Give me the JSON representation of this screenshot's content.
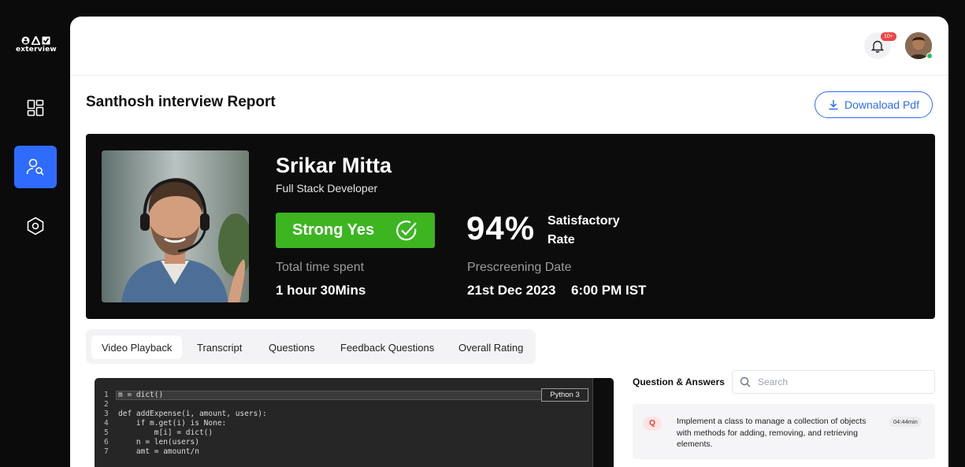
{
  "brand": {
    "name": "exterview"
  },
  "header": {
    "notification_count": "10+"
  },
  "page": {
    "title": "Santhosh interview Report",
    "download_label": "Downaload Pdf"
  },
  "candidate": {
    "name": "Srikar Mitta",
    "role": "Full Stack Developer",
    "verdict": "Strong Yes",
    "score_percent": "94%",
    "score_label_line1": "Satisfactory",
    "score_label_line2": "Rate",
    "time_label": "Total time spent",
    "time_value": "1 hour 30Mins",
    "date_label": "Prescreening Date",
    "date_value": "21st Dec 2023",
    "time_of_day": "6:00 PM IST"
  },
  "tabs": [
    {
      "label": "Video Playback",
      "active": true
    },
    {
      "label": "Transcript",
      "active": false
    },
    {
      "label": "Questions",
      "active": false
    },
    {
      "label": "Feedback Questions",
      "active": false
    },
    {
      "label": "Overall Rating",
      "active": false
    }
  ],
  "code": {
    "language": "Python 3",
    "lines": [
      {
        "n": "1",
        "text": "m = dict()"
      },
      {
        "n": "2",
        "text": ""
      },
      {
        "n": "3",
        "text": "def addExpense(i, amount, users):"
      },
      {
        "n": "4",
        "text": "    if m.get(i) is None:"
      },
      {
        "n": "5",
        "text": "        m[i] = dict()"
      },
      {
        "n": "6",
        "text": "    n = len(users)"
      },
      {
        "n": "7",
        "text": "    amt = amount/n"
      }
    ]
  },
  "qa": {
    "title": "Question & Answers",
    "search_placeholder": "Search",
    "items": [
      {
        "badge": "Q",
        "text": "Implement a class to manage a collection of objects with methods for adding, removing, and retrieving elements.",
        "duration": "04:44min"
      }
    ]
  },
  "colors": {
    "accent": "#2f6bff",
    "verdict_green": "#3cb521",
    "hero_bg": "#0c0c0d"
  }
}
